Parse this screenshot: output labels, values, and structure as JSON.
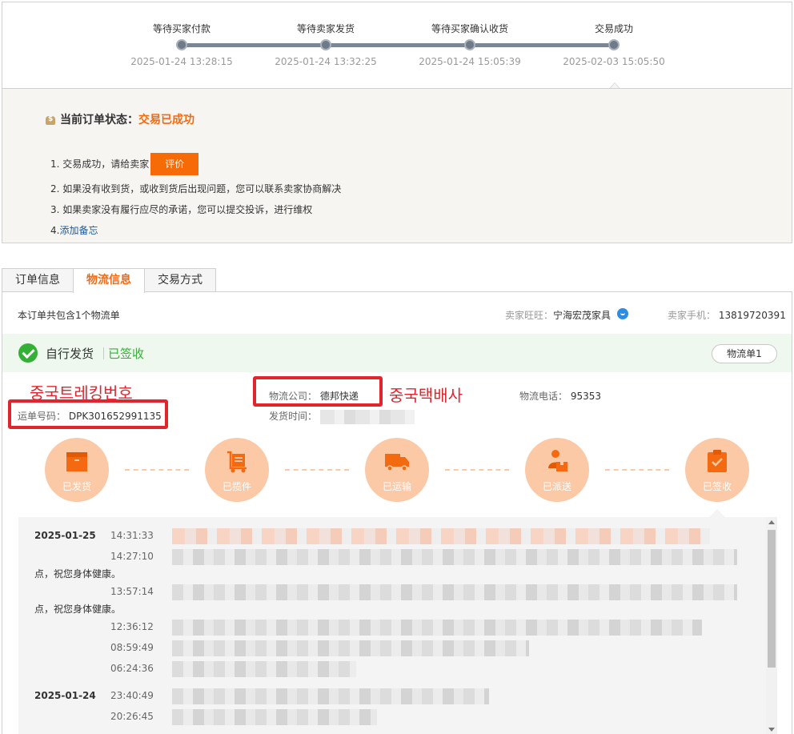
{
  "progress": {
    "steps": [
      {
        "label": "等待买家付款",
        "time": "2025-01-24 13:28:15"
      },
      {
        "label": "等待卖家发货",
        "time": "2025-01-24 13:32:25"
      },
      {
        "label": "等待买家确认收货",
        "time": "2025-01-24 15:05:39"
      },
      {
        "label": "交易成功",
        "time": "2025-02-03 15:05:50"
      }
    ]
  },
  "status": {
    "title_label": "当前订单状态：",
    "title_value": "交易已成功",
    "item1_text": "1. 交易成功，请给卖家",
    "rate_button": "评价",
    "item2": "2. 如果没有收到货，或收到货后出现问题，您可以联系卖家协商解决",
    "item3": "3. 如果卖家没有履行应尽的承诺，您可以提交投诉，进行维权",
    "item4_prefix": "4. ",
    "item4_link": "添加备忘"
  },
  "tabs": [
    {
      "label": "订单信息"
    },
    {
      "label": "物流信息"
    },
    {
      "label": "交易方式"
    }
  ],
  "logistics": {
    "summary": "本订单共包含1个物流单",
    "seller_name_label": "卖家旺旺：",
    "seller_name": "宁海宏茂家具",
    "seller_phone_label": "卖家手机：",
    "seller_phone": "13819720391",
    "ship_method": "自行发货",
    "ship_status": "已签收",
    "ship_tab": "物流单1",
    "waybill_label": "运单号码：",
    "waybill_no": "DPK301652991135",
    "company_label": "物流公司：",
    "company": "德邦快递",
    "ship_time_label": "发货时间：",
    "logi_phone_label": "物流电话：",
    "logi_phone": "95353",
    "annot_tracking": "중국트레킹번호",
    "annot_company": "중국택배사",
    "nodes": [
      {
        "label": "已发货",
        "icon": "box-icon"
      },
      {
        "label": "已揽件",
        "icon": "cart-icon"
      },
      {
        "label": "已运输",
        "icon": "truck-icon"
      },
      {
        "label": "已派送",
        "icon": "courier-icon"
      },
      {
        "label": "已签收",
        "icon": "clipboard-check-icon"
      }
    ],
    "tracking": [
      {
        "date": "2025-01-25",
        "time": "14:31:33"
      },
      {
        "date": "",
        "time": "14:27:10",
        "wrap": "点，祝您身体健康。"
      },
      {
        "date": "",
        "time": "13:57:14",
        "wrap": "点，祝您身体健康。"
      },
      {
        "date": "",
        "time": "12:36:12"
      },
      {
        "date": "",
        "time": "08:59:49"
      },
      {
        "date": "",
        "time": "06:24:36"
      },
      {
        "date": "2025-01-24",
        "time": "23:40:49"
      },
      {
        "date": "",
        "time": "20:26:45"
      }
    ]
  }
}
